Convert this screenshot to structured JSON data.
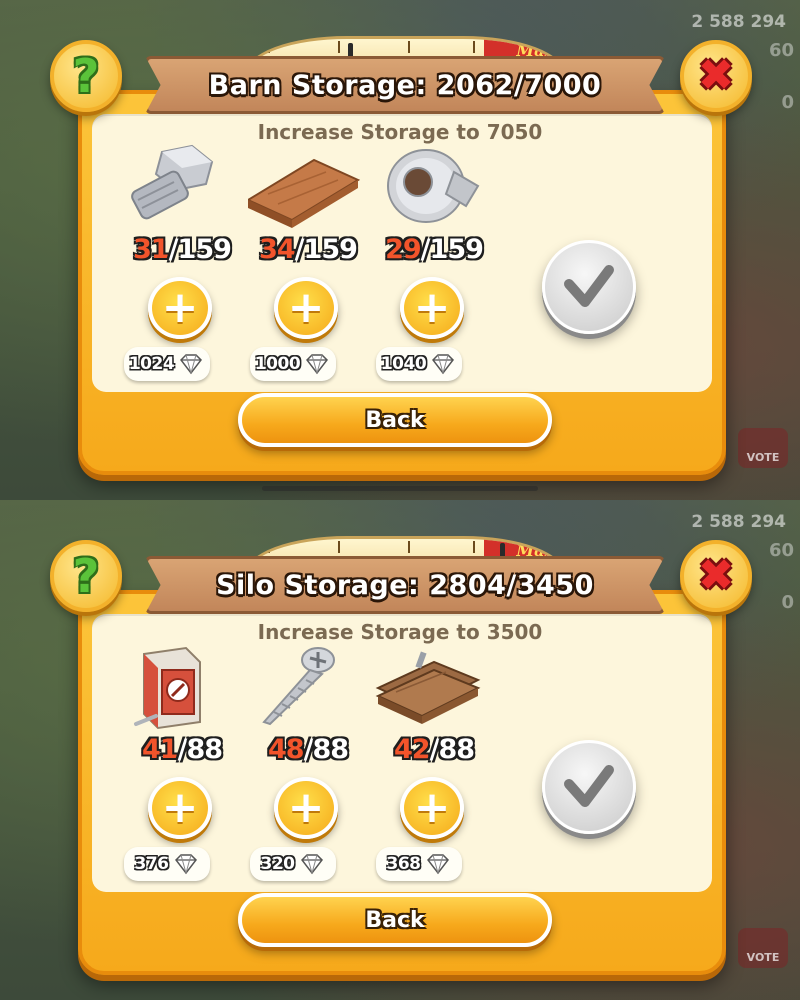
{
  "background": {
    "coins": "2 588 294",
    "side_value_1": "60",
    "side_value_2": "0",
    "vote_label": "VOTE"
  },
  "barn": {
    "title": "Barn Storage: 2062/7000",
    "gauge_max": "Max",
    "subtitle": "Increase Storage to 7050",
    "items": [
      {
        "icon": "bolt-icon",
        "have": "31",
        "sep": "/",
        "need": "159",
        "price": "1024"
      },
      {
        "icon": "plank-icon",
        "have": "34",
        "sep": "/",
        "need": "159",
        "price": "1000"
      },
      {
        "icon": "duct-tape-icon",
        "have": "29",
        "sep": "/",
        "need": "159",
        "price": "1040"
      }
    ],
    "back_label": "Back"
  },
  "silo": {
    "title": "Silo Storage: 2804/3450",
    "gauge_max": "Max",
    "subtitle": "Increase Storage to 3500",
    "items": [
      {
        "icon": "nail-box-icon",
        "have": "41",
        "sep": "/",
        "need": "88",
        "price": "376"
      },
      {
        "icon": "screw-icon",
        "have": "48",
        "sep": "/",
        "need": "88",
        "price": "320"
      },
      {
        "icon": "wood-panel-icon",
        "have": "42",
        "sep": "/",
        "need": "88",
        "price": "368"
      }
    ],
    "back_label": "Back"
  },
  "colors": {
    "panel_orange": "#f6a91b",
    "panel_inner": "#fdf6dc",
    "count_have": "#f2542b",
    "help_green": "#5bc33a",
    "close_red": "#ea2b2b"
  }
}
